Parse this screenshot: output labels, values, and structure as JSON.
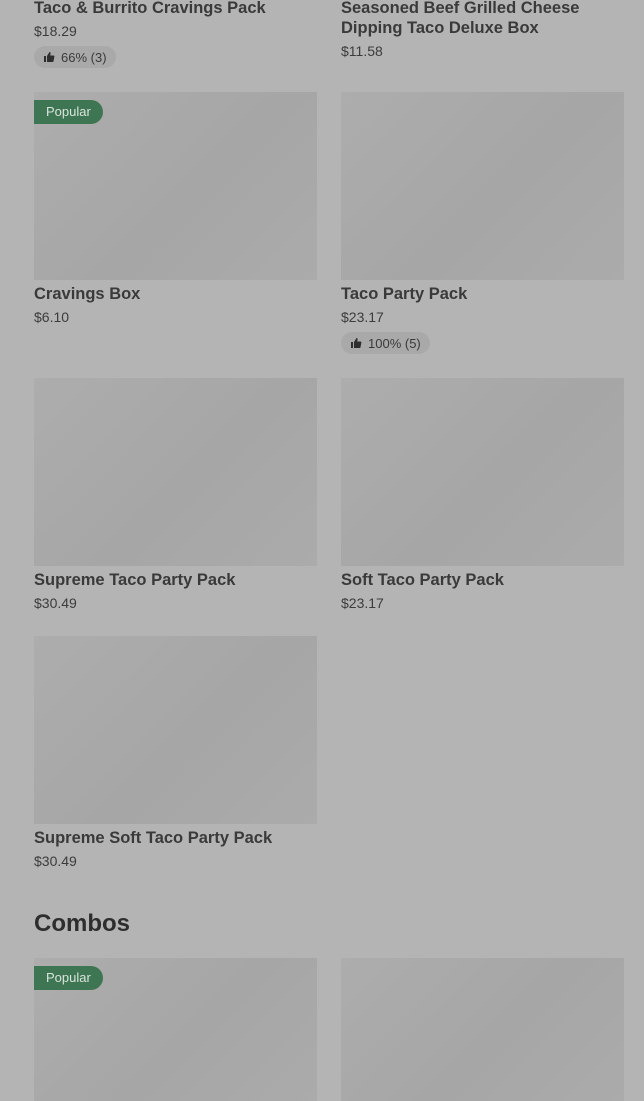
{
  "items": [
    {
      "name": "Taco & Burrito Cravings Pack",
      "price": "$18.29",
      "rating": "66% (3)"
    },
    {
      "name": "Seasoned Beef Grilled Cheese Dipping Taco Deluxe Box",
      "price": "$11.58"
    },
    {
      "name": "Cravings Box",
      "price": "$6.10",
      "badge": "Popular"
    },
    {
      "name": "Taco Party Pack",
      "price": "$23.17",
      "rating": "100% (5)"
    },
    {
      "name": "Supreme Taco Party Pack",
      "price": "$30.49"
    },
    {
      "name": "Soft Taco Party Pack",
      "price": "$23.17"
    },
    {
      "name": "Supreme Soft Taco Party Pack",
      "price": "$30.49"
    }
  ],
  "combos": {
    "title": "Combos",
    "items": [
      {
        "badge": "Popular"
      },
      {}
    ]
  }
}
